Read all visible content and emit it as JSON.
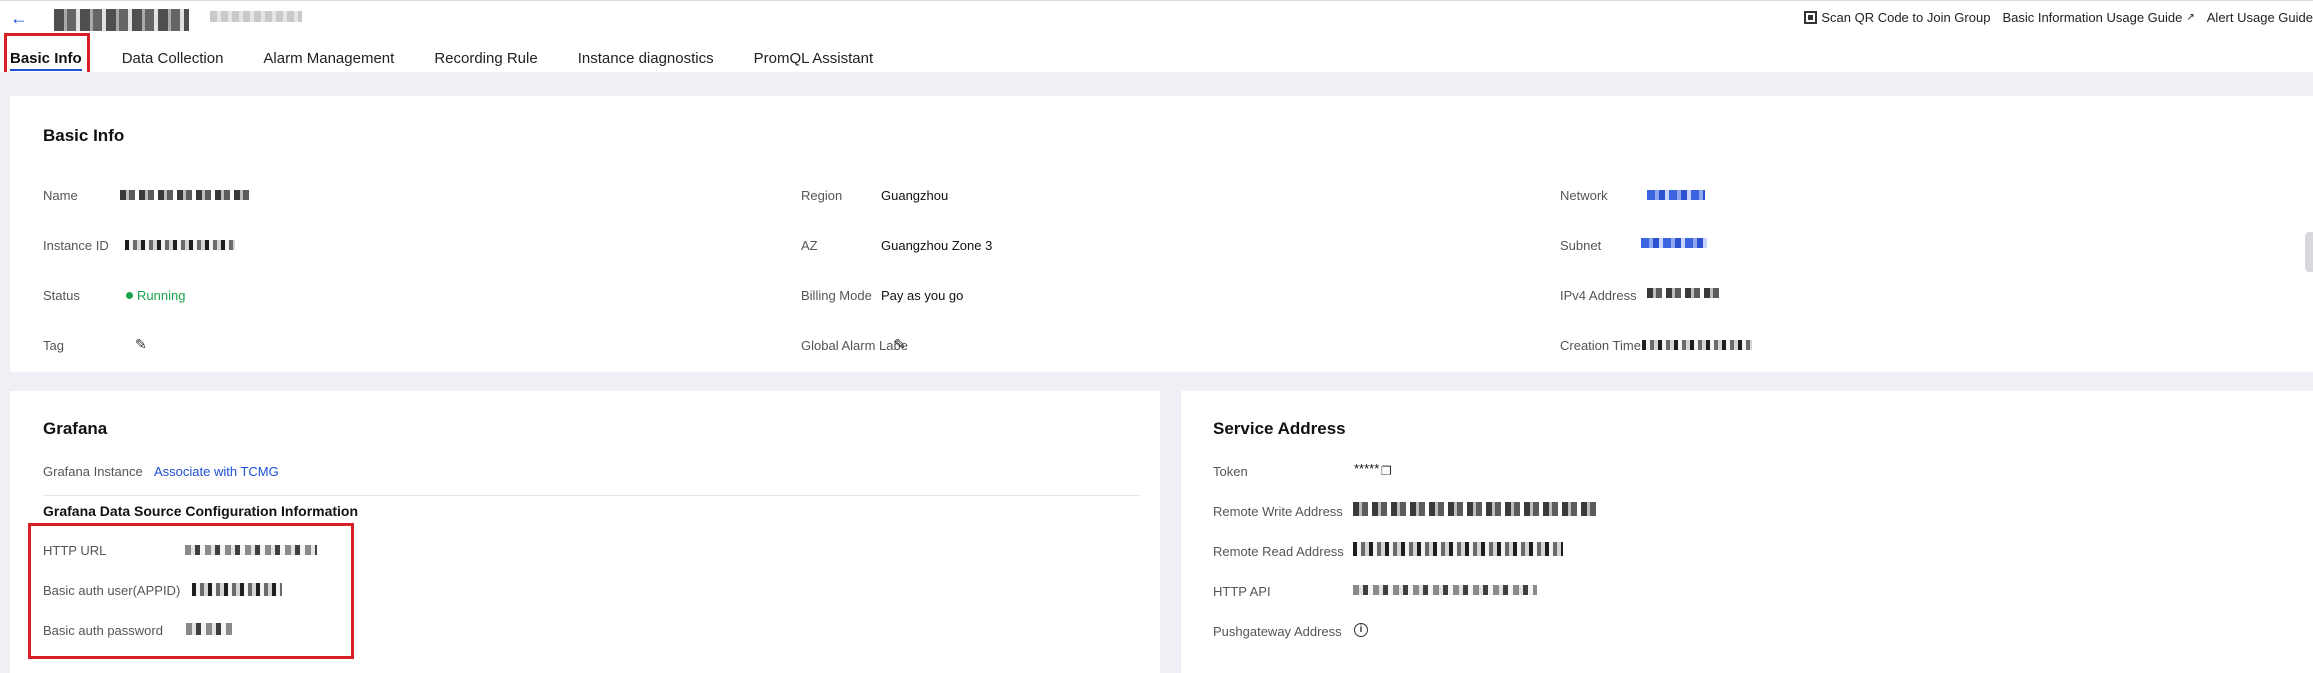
{
  "header": {
    "back_icon": "arrow-left-icon",
    "tabs": [
      {
        "label": "Basic Info",
        "active": true
      },
      {
        "label": "Data Collection"
      },
      {
        "label": "Alarm Management"
      },
      {
        "label": "Recording Rule"
      },
      {
        "label": "Instance diagnostics"
      },
      {
        "label": "PromQL Assistant"
      }
    ],
    "links": {
      "qr": "Scan QR Code to Join Group",
      "basic_guide": "Basic Information Usage Guide",
      "alert_guide": "Alert Usage Guide"
    }
  },
  "basic_info": {
    "title": "Basic Info",
    "name_label": "Name",
    "instance_id_label": "Instance ID",
    "status_label": "Status",
    "status_value": "Running",
    "tag_label": "Tag",
    "region_label": "Region",
    "region_value": "Guangzhou",
    "az_label": "AZ",
    "az_value": "Guangzhou Zone 3",
    "billing_label": "Billing Mode",
    "billing_value": "Pay as you go",
    "global_alarm_label": "Global Alarm Labe",
    "network_label": "Network",
    "subnet_label": "Subnet",
    "ipv4_label": "IPv4 Address",
    "creation_label": "Creation Time"
  },
  "grafana": {
    "title": "Grafana",
    "instance_label": "Grafana Instance",
    "instance_link": "Associate with TCMG",
    "ds_title": "Grafana Data Source Configuration Information",
    "http_url_label": "HTTP URL",
    "auth_user_label": "Basic auth user(APPID)",
    "auth_password_label": "Basic auth password"
  },
  "service": {
    "title": "Service Address",
    "token_label": "Token",
    "token_value": "*****",
    "remote_write_label": "Remote Write Address",
    "remote_read_label": "Remote Read Address",
    "http_api_label": "HTTP API",
    "pushgateway_label": "Pushgateway Address"
  },
  "colors": {
    "accent": "#1d4fd7",
    "running": "#1aa34a",
    "highlight": "#d91f26"
  }
}
